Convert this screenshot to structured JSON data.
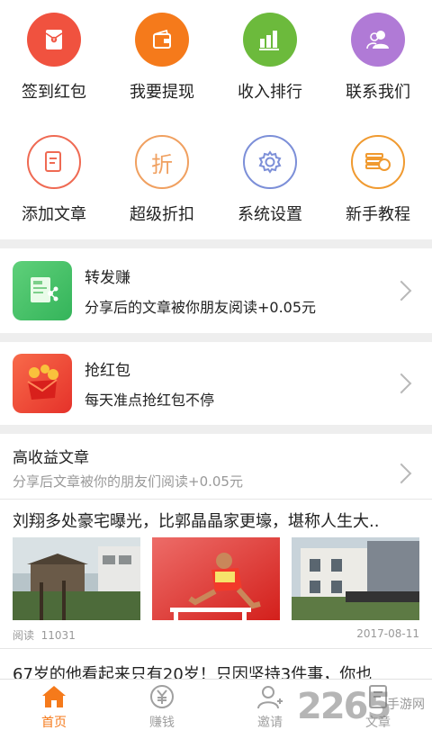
{
  "grid_row1": [
    {
      "label": "签到红包",
      "icon": "red-envelope-icon",
      "color": "#f0523f"
    },
    {
      "label": "我要提现",
      "icon": "wallet-icon",
      "color": "#f57a1b"
    },
    {
      "label": "收入排行",
      "icon": "bar-chart-icon",
      "color": "#6cba3c"
    },
    {
      "label": "联系我们",
      "icon": "contacts-icon",
      "color": "#b07ad6"
    }
  ],
  "grid_row2": [
    {
      "label": "添加文章",
      "icon": "document-icon",
      "color": "#ef6a53"
    },
    {
      "label": "超级折扣",
      "icon": "discount-icon",
      "color": "#f0a060",
      "glyph": "折"
    },
    {
      "label": "系统设置",
      "icon": "gear-icon",
      "color": "#7c8fd8"
    },
    {
      "label": "新手教程",
      "icon": "coins-icon",
      "color": "#f09a30"
    }
  ],
  "share_card": {
    "title": "转发赚",
    "subtitle": "分享后的文章被你朋友阅读+0.05元"
  },
  "redpacket_card": {
    "title": "抢红包",
    "subtitle": "每天准点抢红包不停"
  },
  "section": {
    "title": "高收益文章",
    "subtitle": "分享后文章被你的朋友们阅读+0.05元"
  },
  "article1": {
    "title": "刘翔多处豪宅曝光，比郭晶晶家更壕，堪称人生大..",
    "reads_label": "阅读",
    "reads": "11031",
    "date": "2017-08-11"
  },
  "article2": {
    "title": "67岁的他看起来只有20岁！只因坚持3件事，你也"
  },
  "tabbar": [
    {
      "label": "首页",
      "icon": "home-icon",
      "active": true
    },
    {
      "label": "赚钱",
      "icon": "yen-coin-icon",
      "active": false
    },
    {
      "label": "邀请",
      "icon": "invite-user-icon",
      "active": false
    },
    {
      "label": "文章",
      "icon": "article-icon",
      "active": false
    }
  ],
  "watermark": {
    "number": "2265",
    "suffix": "手游网"
  },
  "colors": {
    "accent": "#f57a1b",
    "inactive": "#a0a0a0"
  }
}
